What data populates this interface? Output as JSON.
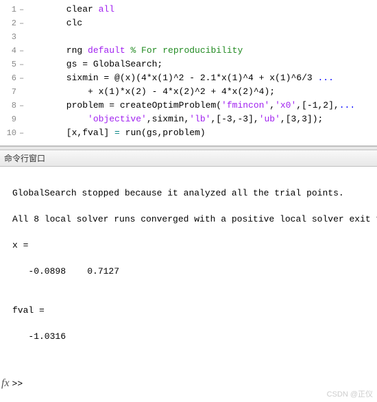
{
  "editor": {
    "lines": [
      {
        "num": "1",
        "dash": "–",
        "segments": [
          {
            "t": "      clear ",
            "c": ""
          },
          {
            "t": "all",
            "c": "kw-purple"
          }
        ]
      },
      {
        "num": "2",
        "dash": "–",
        "segments": [
          {
            "t": "      clc",
            "c": ""
          }
        ]
      },
      {
        "num": "3",
        "dash": "",
        "segments": [
          {
            "t": "",
            "c": ""
          }
        ]
      },
      {
        "num": "4",
        "dash": "–",
        "segments": [
          {
            "t": "      rng ",
            "c": ""
          },
          {
            "t": "default",
            "c": "kw-purple"
          },
          {
            "t": " ",
            "c": ""
          },
          {
            "t": "% For reproducibility",
            "c": "comment"
          }
        ]
      },
      {
        "num": "5",
        "dash": "–",
        "segments": [
          {
            "t": "      gs = GlobalSearch;",
            "c": ""
          }
        ]
      },
      {
        "num": "6",
        "dash": "–",
        "segments": [
          {
            "t": "      sixmin = @(x)(4*x(1)^2 - 2.1*x(1)^4 + x(1)^6/3 ",
            "c": ""
          },
          {
            "t": "...",
            "c": "kw-blue"
          }
        ]
      },
      {
        "num": "7",
        "dash": "",
        "segments": [
          {
            "t": "          + x(1)*x(2) - 4*x(2)^2 + 4*x(2)^4);",
            "c": ""
          }
        ]
      },
      {
        "num": "8",
        "dash": "–",
        "segments": [
          {
            "t": "      problem = createOptimProblem(",
            "c": ""
          },
          {
            "t": "'fmincon'",
            "c": "str"
          },
          {
            "t": ",",
            "c": ""
          },
          {
            "t": "'x0'",
            "c": "str"
          },
          {
            "t": ",[-1,2],",
            "c": ""
          },
          {
            "t": "...",
            "c": "kw-blue"
          }
        ]
      },
      {
        "num": "9",
        "dash": "",
        "segments": [
          {
            "t": "          ",
            "c": ""
          },
          {
            "t": "'objective'",
            "c": "str"
          },
          {
            "t": ",sixmin,",
            "c": ""
          },
          {
            "t": "'lb'",
            "c": "str"
          },
          {
            "t": ",[-3,-3],",
            "c": ""
          },
          {
            "t": "'ub'",
            "c": "str"
          },
          {
            "t": ",[3,3]);",
            "c": ""
          }
        ]
      },
      {
        "num": "10",
        "dash": "–",
        "segments": [
          {
            "t": "      [x,fval] ",
            "c": ""
          },
          {
            "t": "=",
            "c": "kw-teal"
          },
          {
            "t": " run(gs,problem)",
            "c": ""
          }
        ]
      }
    ]
  },
  "cmd": {
    "title": "命令行窗口",
    "output": "\nGlobalSearch stopped because it analyzed all the trial points.\n\nAll 8 local solver runs converged with a positive local solver exit flag.\n\nx =\n\n   -0.0898    0.7127\n\n\nfval =\n\n   -1.0316\n",
    "prompt": ">>"
  },
  "fx_label": "fx",
  "watermark": "CSDN @正仪"
}
